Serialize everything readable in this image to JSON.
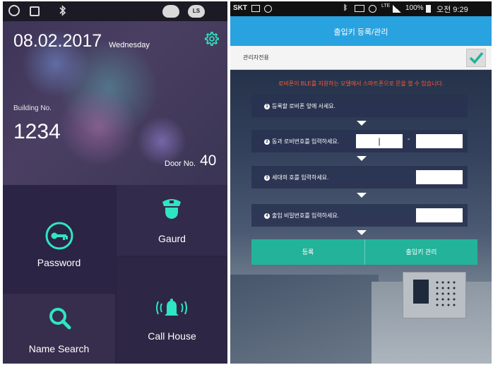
{
  "left_phone": {
    "status_icons": [
      "alarm-icon",
      "card-icon",
      "bluetooth-icon",
      "cloud-icon",
      "cloud-ls-icon"
    ],
    "cloud_badge": "LS",
    "date": "08.02.2017",
    "weekday": "Wednesday",
    "building_label": "Building No.",
    "building_number": "1234",
    "door_label": "Door No.",
    "door_number": "40",
    "tiles": {
      "password": "Password",
      "guard": "Gaurd",
      "name_search": "Name Search",
      "call_house": "Call House"
    },
    "accent_color": "#2ee6c2"
  },
  "right_phone": {
    "status": {
      "carrier": "SKT",
      "battery": "100%",
      "time": "오전 9:29",
      "network": "LTE"
    },
    "title": "출입키 등록/관리",
    "admin_label": "관리자전용",
    "warning": "로비폰이 BLE를 지원하는 모델에서 스마트폰으로 문을 열 수 있습니다.",
    "steps": [
      "등록할 로비폰 앞에 서세요.",
      "동과 로비번호를 입력하세요.",
      "세대의 호를 입력하세요.",
      "출입 비밀번호를 입력하세요."
    ],
    "step_numbers": [
      "1",
      "2",
      "3",
      "4"
    ],
    "dong_value": "|",
    "buttons": {
      "register": "등록",
      "manage": "출입키 관리"
    },
    "title_bar_color": "#29a2e0",
    "button_color": "#23b39a"
  }
}
